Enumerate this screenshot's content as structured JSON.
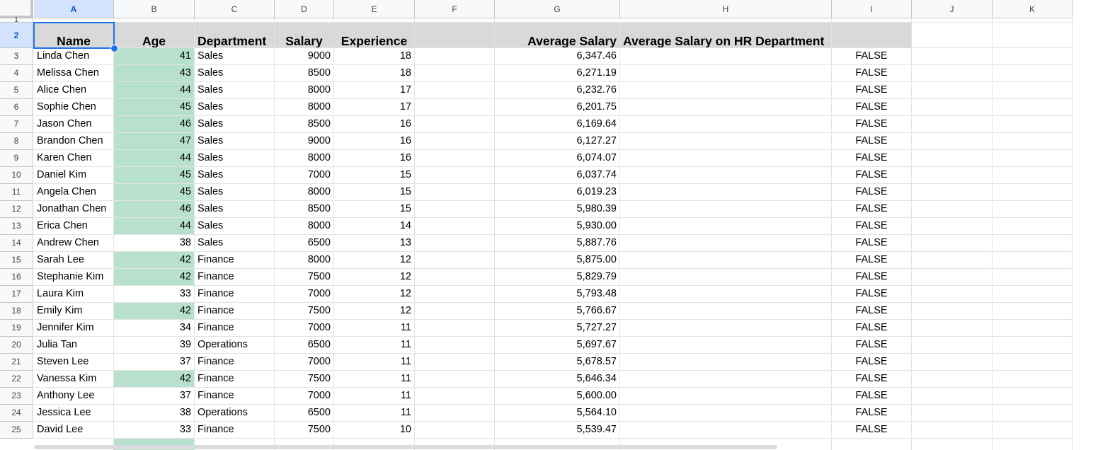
{
  "columns": [
    "A",
    "B",
    "C",
    "D",
    "E",
    "F",
    "G",
    "H",
    "I",
    "J",
    "K"
  ],
  "rows_numbers": [
    "1",
    "2",
    "3",
    "4",
    "5",
    "6",
    "7",
    "8",
    "9",
    "10",
    "11",
    "12",
    "13",
    "14",
    "15",
    "16",
    "17",
    "18",
    "19",
    "20",
    "21",
    "22",
    "23",
    "24",
    "25"
  ],
  "headers": {
    "name": "Name",
    "age": "Age",
    "department": "Department",
    "salary": "Salary",
    "experience": "Experience",
    "average_salary": "Average Salary",
    "average_salary_hr": "Average Salary on HR Department"
  },
  "rows": [
    {
      "name": "Linda Chen",
      "age": "41",
      "dept": "Sales",
      "salary": "9000",
      "exp": "18",
      "avg": "6,347.46",
      "flag": "FALSE",
      "green": true
    },
    {
      "name": "Melissa Chen",
      "age": "43",
      "dept": "Sales",
      "salary": "8500",
      "exp": "18",
      "avg": "6,271.19",
      "flag": "FALSE",
      "green": true
    },
    {
      "name": "Alice Chen",
      "age": "44",
      "dept": "Sales",
      "salary": "8000",
      "exp": "17",
      "avg": "6,232.76",
      "flag": "FALSE",
      "green": true
    },
    {
      "name": "Sophie Chen",
      "age": "45",
      "dept": "Sales",
      "salary": "8000",
      "exp": "17",
      "avg": "6,201.75",
      "flag": "FALSE",
      "green": true
    },
    {
      "name": "Jason Chen",
      "age": "46",
      "dept": "Sales",
      "salary": "8500",
      "exp": "16",
      "avg": "6,169.64",
      "flag": "FALSE",
      "green": true
    },
    {
      "name": "Brandon Chen",
      "age": "47",
      "dept": "Sales",
      "salary": "9000",
      "exp": "16",
      "avg": "6,127.27",
      "flag": "FALSE",
      "green": true
    },
    {
      "name": "Karen Chen",
      "age": "44",
      "dept": "Sales",
      "salary": "8000",
      "exp": "16",
      "avg": "6,074.07",
      "flag": "FALSE",
      "green": true
    },
    {
      "name": "Daniel Kim",
      "age": "45",
      "dept": "Sales",
      "salary": "7000",
      "exp": "15",
      "avg": "6,037.74",
      "flag": "FALSE",
      "green": true
    },
    {
      "name": "Angela Chen",
      "age": "45",
      "dept": "Sales",
      "salary": "8000",
      "exp": "15",
      "avg": "6,019.23",
      "flag": "FALSE",
      "green": true
    },
    {
      "name": "Jonathan Chen",
      "age": "46",
      "dept": "Sales",
      "salary": "8500",
      "exp": "15",
      "avg": "5,980.39",
      "flag": "FALSE",
      "green": true
    },
    {
      "name": "Erica Chen",
      "age": "44",
      "dept": "Sales",
      "salary": "8000",
      "exp": "14",
      "avg": "5,930.00",
      "flag": "FALSE",
      "green": true
    },
    {
      "name": "Andrew Chen",
      "age": "38",
      "dept": "Sales",
      "salary": "6500",
      "exp": "13",
      "avg": "5,887.76",
      "flag": "FALSE",
      "green": false
    },
    {
      "name": "Sarah Lee",
      "age": "42",
      "dept": "Finance",
      "salary": "8000",
      "exp": "12",
      "avg": "5,875.00",
      "flag": "FALSE",
      "green": true
    },
    {
      "name": "Stephanie Kim",
      "age": "42",
      "dept": "Finance",
      "salary": "7500",
      "exp": "12",
      "avg": "5,829.79",
      "flag": "FALSE",
      "green": true
    },
    {
      "name": "Laura Kim",
      "age": "33",
      "dept": "Finance",
      "salary": "7000",
      "exp": "12",
      "avg": "5,793.48",
      "flag": "FALSE",
      "green": false
    },
    {
      "name": "Emily Kim",
      "age": "42",
      "dept": "Finance",
      "salary": "7500",
      "exp": "12",
      "avg": "5,766.67",
      "flag": "FALSE",
      "green": true
    },
    {
      "name": "Jennifer Kim",
      "age": "34",
      "dept": "Finance",
      "salary": "7000",
      "exp": "11",
      "avg": "5,727.27",
      "flag": "FALSE",
      "green": false
    },
    {
      "name": "Julia Tan",
      "age": "39",
      "dept": "Operations",
      "salary": "6500",
      "exp": "11",
      "avg": "5,697.67",
      "flag": "FALSE",
      "green": false
    },
    {
      "name": "Steven Lee",
      "age": "37",
      "dept": "Finance",
      "salary": "7000",
      "exp": "11",
      "avg": "5,678.57",
      "flag": "FALSE",
      "green": false
    },
    {
      "name": "Vanessa Kim",
      "age": "42",
      "dept": "Finance",
      "salary": "7500",
      "exp": "11",
      "avg": "5,646.34",
      "flag": "FALSE",
      "green": true
    },
    {
      "name": "Anthony Lee",
      "age": "37",
      "dept": "Finance",
      "salary": "7000",
      "exp": "11",
      "avg": "5,600.00",
      "flag": "FALSE",
      "green": false
    },
    {
      "name": "Jessica Lee",
      "age": "38",
      "dept": "Operations",
      "salary": "6500",
      "exp": "11",
      "avg": "5,564.10",
      "flag": "FALSE",
      "green": false
    },
    {
      "name": "David Lee",
      "age": "33",
      "dept": "Finance",
      "salary": "7500",
      "exp": "10",
      "avg": "5,539.47",
      "flag": "FALSE",
      "green": false
    }
  ],
  "colors": {
    "highlight_green": "#b7e1cd",
    "header_gray": "#d9d9d9",
    "selection_blue": "#1a73e8"
  }
}
